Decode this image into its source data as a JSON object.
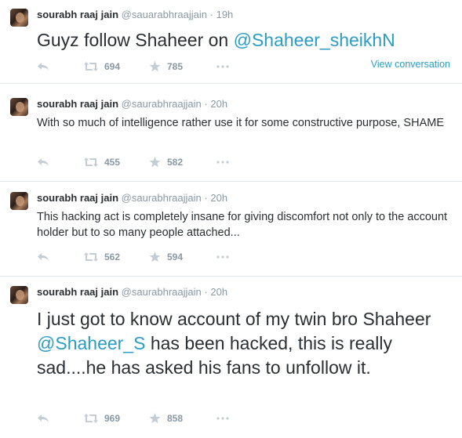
{
  "tweets": [
    {
      "fullname": "sourabh raaj jain",
      "screen_name": "@sauarabhraajjain",
      "time": "19h",
      "text_parts": [
        "Guyz follow Shaheer on ",
        "@Shaheer_sheikhN",
        ""
      ],
      "retweets": "694",
      "favorites": "785",
      "view_conversation": "View conversation"
    },
    {
      "fullname": "sourabh raaj jain",
      "screen_name": "@saurabhraajjain",
      "time": "20h",
      "text": "With so much of intelligence rather use it for some constructive purpose, SHAME",
      "retweets": "455",
      "favorites": "582"
    },
    {
      "fullname": "sourabh raaj jain",
      "screen_name": "@saurabhraajjain",
      "time": "20h",
      "text": "This hacking act is completely insane for giving discomfort not only to the account holder but  to so many people attached...",
      "retweets": "562",
      "favorites": "594"
    },
    {
      "fullname": "sourabh raaj jain",
      "screen_name": "@saurabhraajjain",
      "time": "20h",
      "text_parts": [
        "I just got to know account of my twin bro Shaheer ",
        "@Shaheer_S",
        " has been hacked, this is really sad....he has asked his fans to unfollow it."
      ],
      "retweets": "969",
      "favorites": "858"
    }
  ],
  "separator": "·",
  "colors": {
    "link": "#2b9dc4",
    "muted": "#8899a6",
    "text": "#292f33",
    "border": "#e1e8ed"
  },
  "icons": [
    "reply-icon",
    "retweet-icon",
    "favorite-icon",
    "more-icon"
  ]
}
